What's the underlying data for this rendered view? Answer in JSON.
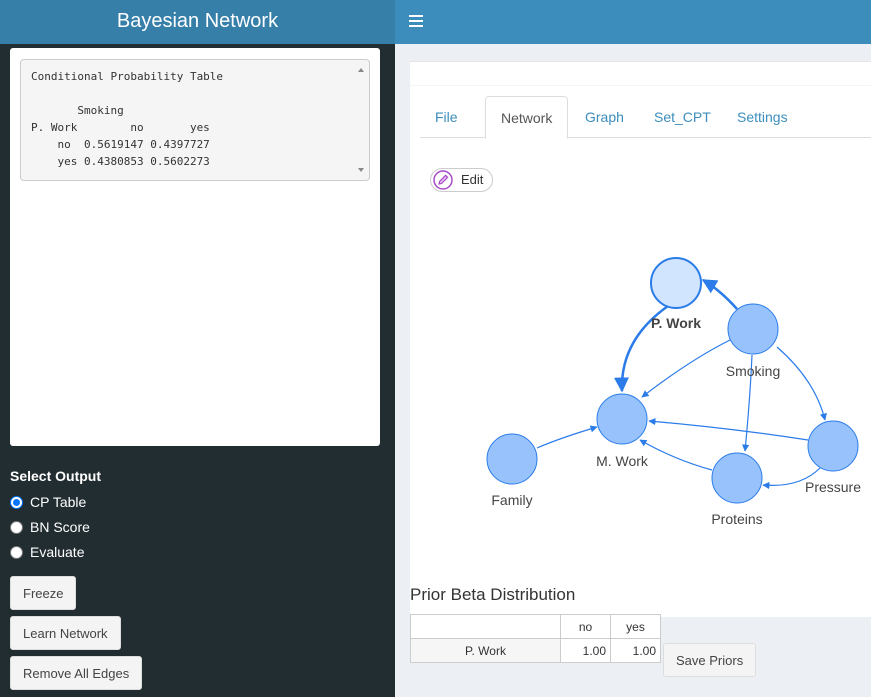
{
  "header": {
    "title": "Bayesian Network",
    "menu_icon": "hamburger-icon"
  },
  "sidebar": {
    "cpt_text": "Conditional Probability Table\n\n       Smoking\nP. Work        no       yes\n    no  0.5619147 0.4397727\n    yes 0.4380853 0.5602273",
    "select_output_label": "Select Output",
    "options": [
      {
        "label": "CP Table",
        "checked": true
      },
      {
        "label": "BN Score",
        "checked": false
      },
      {
        "label": "Evaluate",
        "checked": false
      }
    ],
    "buttons": {
      "freeze": "Freeze",
      "learn": "Learn Network",
      "remove": "Remove All Edges"
    }
  },
  "tabs": [
    "File",
    "Network",
    "Graph",
    "Set_CPT",
    "Settings"
  ],
  "active_tab": "Network",
  "edit_label": "Edit",
  "graph": {
    "nodes": [
      "P. Work",
      "Smoking",
      "M. Work",
      "Family",
      "Pressure",
      "Proteins"
    ],
    "selected_node": "P. Work",
    "colors": {
      "node_fill": "#97c2fc",
      "node_stroke": "#2b7ce9",
      "selected_fill": "#d2e5ff",
      "edge": "#2b7ce9"
    }
  },
  "prior": {
    "title": "Prior Beta Distribution",
    "columns": [
      "",
      "no",
      "yes"
    ],
    "row": {
      "label": "P. Work",
      "no": "1.00",
      "yes": "1.00"
    },
    "save_label": "Save Priors"
  }
}
